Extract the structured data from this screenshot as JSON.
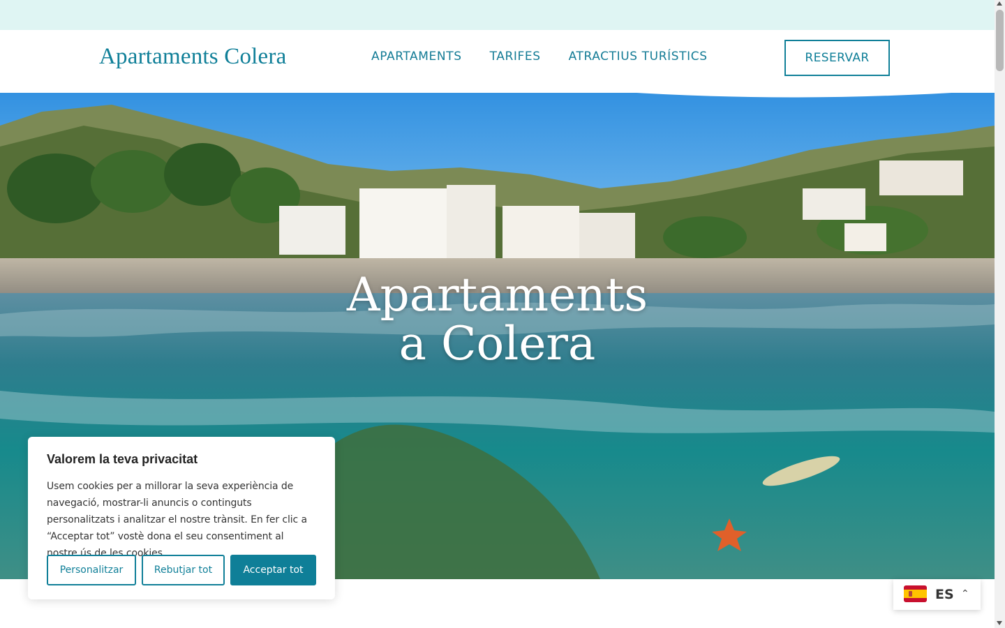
{
  "header": {
    "logo": "Apartaments Colera",
    "nav": [
      {
        "label": "APARTAMENTS"
      },
      {
        "label": "TARIFES"
      },
      {
        "label": "ATRACTIUS TURÍSTICS"
      }
    ],
    "cta_label": "RESERVAR"
  },
  "hero": {
    "title_line1": "Apartaments",
    "title_line2": "a Colera"
  },
  "cookie": {
    "title": "Valorem la teva privacitat",
    "text": "Usem cookies per a millorar la seva experiència de navegació, mostrar-li anuncis o continguts personalitzats i analitzar el nostre trànsit. En fer clic a “Acceptar tot” vostè dona el seu consentiment al nostre ús de les cookies.",
    "buttons": {
      "customize": "Personalitzar",
      "reject": "Rebutjar tot",
      "accept": "Acceptar tot"
    }
  },
  "language": {
    "code": "ES",
    "flag_icon": "spain-flag-icon",
    "caret_icon": "chevron-up-icon"
  },
  "colors": {
    "brand": "#0f7f98",
    "top_bar": "#dff5f3"
  }
}
